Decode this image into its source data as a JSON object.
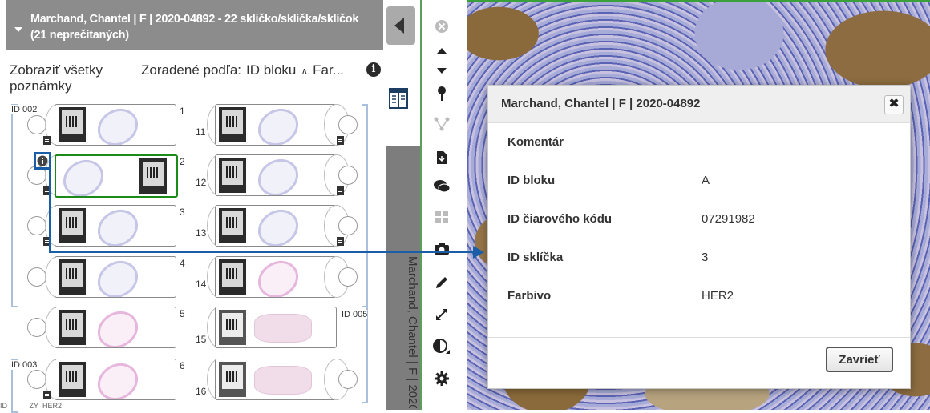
{
  "tray": {
    "header_title": "Marchand, Chantel | F | 2020-04892 - 22 sklíčko/sklíčka/sklíčok (21 neprečítaných)",
    "show_notes": "Zobraziť všetky poznámky",
    "sort_label": "Zoradené podľa:",
    "sort_key": "ID bloku",
    "sort_key2": "Far...",
    "blocks": [
      "ID 002",
      "ID 005",
      "ID 003"
    ],
    "slides_left": [
      "1",
      "2",
      "3",
      "4",
      "5",
      "6"
    ],
    "slides_right": [
      "11",
      "12",
      "13",
      "14",
      "15",
      "16"
    ],
    "bottom_strip": "ID           ZY  HER2"
  },
  "vertical_title": "Marchand, Chantel | F | 2020",
  "toolbar": {
    "icons": [
      "close-icon",
      "arrow-up-icon",
      "arrow-down-icon",
      "pin-icon",
      "network-icon",
      "download-doc-icon",
      "comments-icon",
      "grid-icon",
      "camera-icon",
      "pencil-icon",
      "expand-icon",
      "contrast-icon",
      "gear-icon"
    ]
  },
  "dialog": {
    "title": "Marchand, Chantel | F | 2020-04892",
    "close_glyph": "✖",
    "fields": [
      {
        "label": "Komentár",
        "value": ""
      },
      {
        "label": "ID bloku",
        "value": "A"
      },
      {
        "label": "ID čiarového kódu",
        "value": "07291982"
      },
      {
        "label": "ID sklíčka",
        "value": "3"
      },
      {
        "label": "Farbivo",
        "value": "HER2"
      }
    ],
    "close_button": "Zavrieť"
  },
  "colors": {
    "callout": "#1a5ea8",
    "selected_slide": "#1a8a1a",
    "header_bg": "#8c8c8c"
  }
}
